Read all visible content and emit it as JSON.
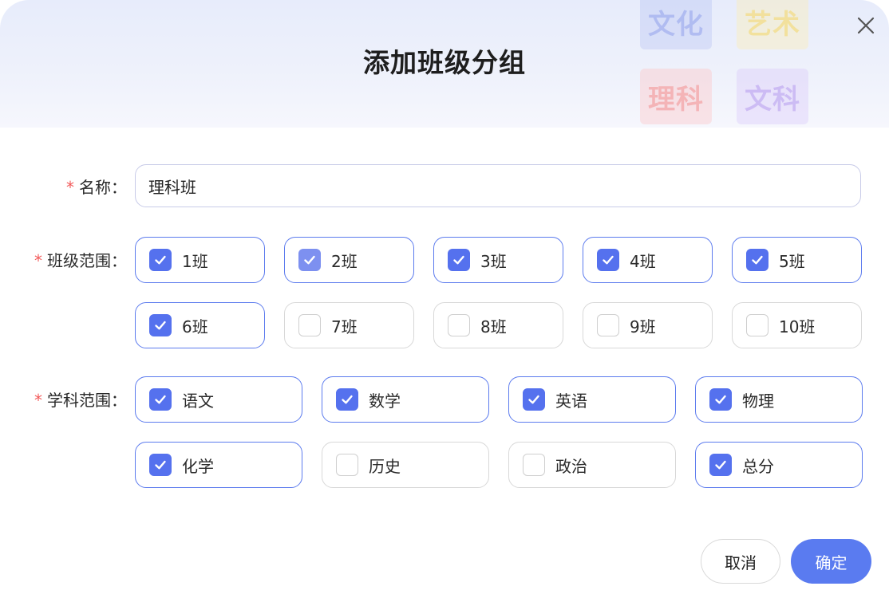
{
  "dialog": {
    "title": "添加班级分组",
    "decor_tiles": [
      "文化",
      "艺术",
      "理科",
      "文科"
    ]
  },
  "form": {
    "name": {
      "required_mark": "*",
      "label": "名称：",
      "value": "理科班",
      "placeholder": ""
    },
    "class_range": {
      "required_mark": "*",
      "label": "班级范围：",
      "options": [
        {
          "label": "1班",
          "checked": true
        },
        {
          "label": "2班",
          "checked": true
        },
        {
          "label": "3班",
          "checked": true
        },
        {
          "label": "4班",
          "checked": true
        },
        {
          "label": "5班",
          "checked": true
        },
        {
          "label": "6班",
          "checked": true
        },
        {
          "label": "7班",
          "checked": false
        },
        {
          "label": "8班",
          "checked": false
        },
        {
          "label": "9班",
          "checked": false
        },
        {
          "label": "10班",
          "checked": false
        }
      ]
    },
    "subject_range": {
      "required_mark": "*",
      "label": "学科范围：",
      "options": [
        {
          "label": "语文",
          "checked": true
        },
        {
          "label": "数学",
          "checked": true
        },
        {
          "label": "英语",
          "checked": true
        },
        {
          "label": "物理",
          "checked": true
        },
        {
          "label": "化学",
          "checked": true
        },
        {
          "label": "历史",
          "checked": false
        },
        {
          "label": "政治",
          "checked": false
        },
        {
          "label": "总分",
          "checked": true
        }
      ]
    }
  },
  "footer": {
    "cancel_label": "取消",
    "confirm_label": "确定"
  },
  "colors": {
    "accent": "#5a7bf0",
    "required": "#f25a5a",
    "checked_border": "#5c7bee"
  }
}
